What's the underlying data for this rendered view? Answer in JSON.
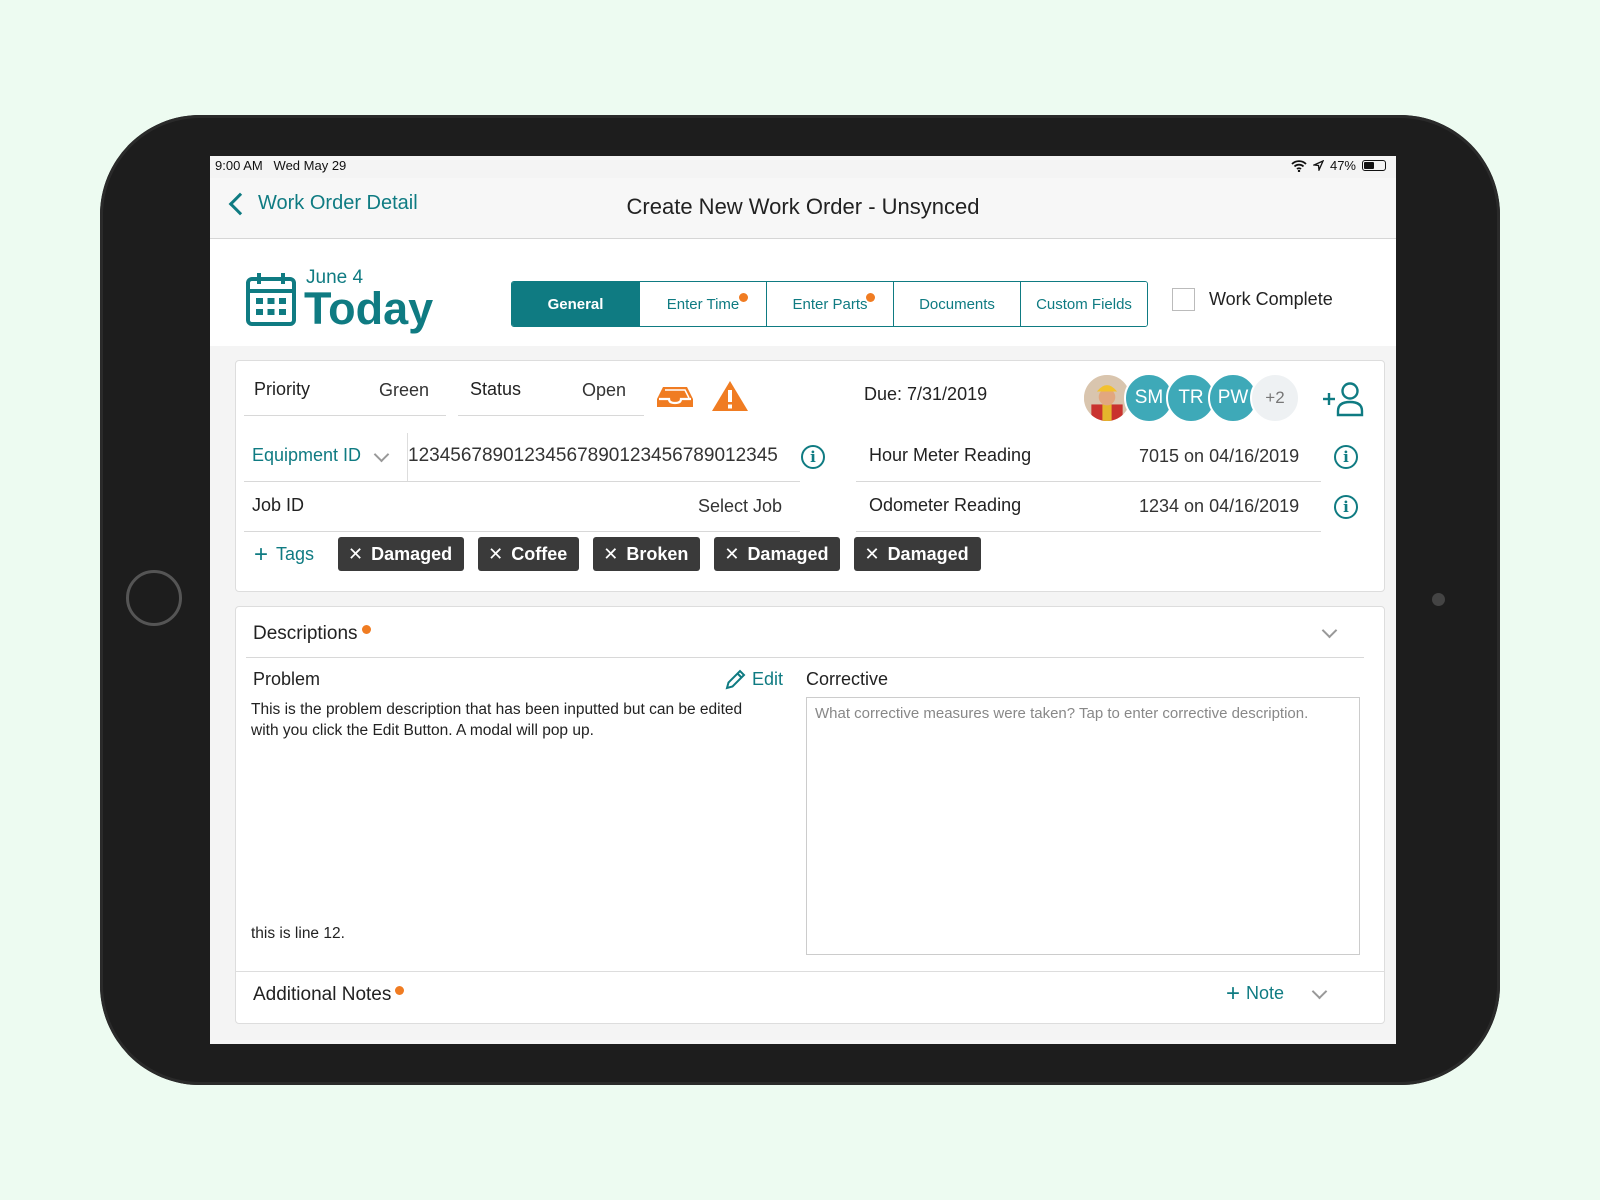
{
  "status_bar": {
    "time": "9:00 AM",
    "date": "Wed May 29",
    "battery": "47%",
    "battery_level": 0.47
  },
  "nav": {
    "back_label": "Work Order Detail",
    "title": "Create New Work Order - Unsynced"
  },
  "header": {
    "date_small": "June 4",
    "date_big": "Today",
    "tabs": [
      {
        "label": "General",
        "active": true,
        "dot": false
      },
      {
        "label": "Enter Time",
        "active": false,
        "dot": true
      },
      {
        "label": "Enter Parts",
        "active": false,
        "dot": true
      },
      {
        "label": "Documents",
        "active": false,
        "dot": false
      },
      {
        "label": "Custom Fields",
        "active": false,
        "dot": false
      }
    ],
    "work_complete_label": "Work Complete"
  },
  "details": {
    "priority_label": "Priority",
    "priority_value": "Green",
    "status_label": "Status",
    "status_value": "Open",
    "due": "Due: 7/31/2019",
    "assignees": [
      "SM",
      "TR",
      "PW"
    ],
    "assignees_more": "+2",
    "equipment_label": "Equipment ID",
    "equipment_value": "12345678901234567890123456789012345",
    "job_label": "Job ID",
    "job_value": "Select Job",
    "hour_meter_label": "Hour Meter Reading",
    "hour_meter_value": "7015 on 04/16/2019",
    "odometer_label": "Odometer Reading",
    "odometer_value": "1234 on 04/16/2019",
    "tags_label": "Tags",
    "tags": [
      "Damaged",
      "Coffee",
      "Broken",
      "Damaged",
      "Damaged"
    ]
  },
  "descriptions": {
    "title": "Descriptions",
    "problem_label": "Problem",
    "edit_label": "Edit",
    "problem_text": "This is the problem description that has been inputted but can be edited with you click the Edit Button. A modal will pop up.",
    "problem_last_line": "this is line 12.",
    "corrective_label": "Corrective",
    "corrective_placeholder": "What corrective measures were taken? Tap to enter corrective description."
  },
  "notes": {
    "title": "Additional Notes",
    "add_label": "Note"
  },
  "colors": {
    "accent": "#0f7b82",
    "warning": "#f07c22",
    "tag_bg": "#3a3a3a"
  }
}
